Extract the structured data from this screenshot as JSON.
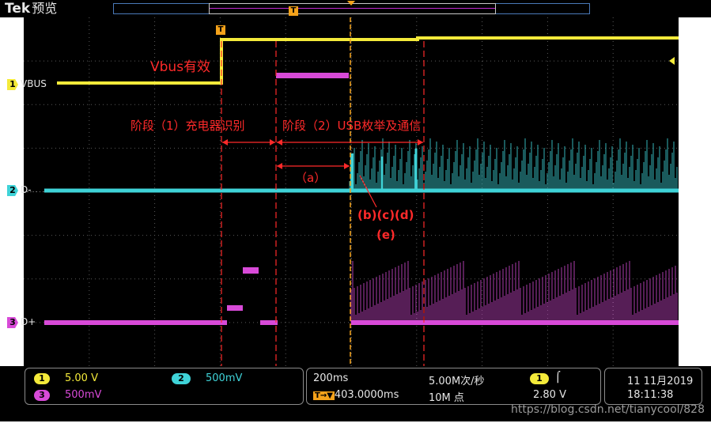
{
  "header": {
    "brand": "Tek",
    "mode": "预览",
    "trigger_marker": "T"
  },
  "channels": [
    {
      "num": "1",
      "name": "VBUS",
      "color": "#f4ea3a"
    },
    {
      "num": "2",
      "name": "D-",
      "color": "#3fd3d8"
    },
    {
      "num": "3",
      "name": "D+",
      "color": "#d84ad8"
    }
  ],
  "annotations": {
    "vbus_valid": "Vbus有效",
    "stage1": "阶段（1）充电器识别",
    "stage2": "阶段（2）USB枚举及通信",
    "a": "（a）",
    "bcd": "(b)(c)(d)",
    "e": "(e)",
    "color": "#ff2a2a"
  },
  "status": {
    "ch1_num": "1",
    "ch1_scale": "5.00 V",
    "ch2_num": "2",
    "ch2_scale": "500mV",
    "ch3_num": "3",
    "ch3_scale": "500mV",
    "timebase": "200ms",
    "sample_rate": "5.00M次/秒",
    "trigger_pos_icon": "T→▼",
    "trigger_pos": "403.0000ms",
    "record_length": "10M 点",
    "trig_source": "1",
    "trig_slope_icon": "rising-edge-icon",
    "trig_slope_glyph": "⌠",
    "trig_level": "2.80 V",
    "date": "11 11月2019",
    "time": "18:11:38"
  },
  "watermark": "https://blog.csdn.net/tianycool/828"
}
